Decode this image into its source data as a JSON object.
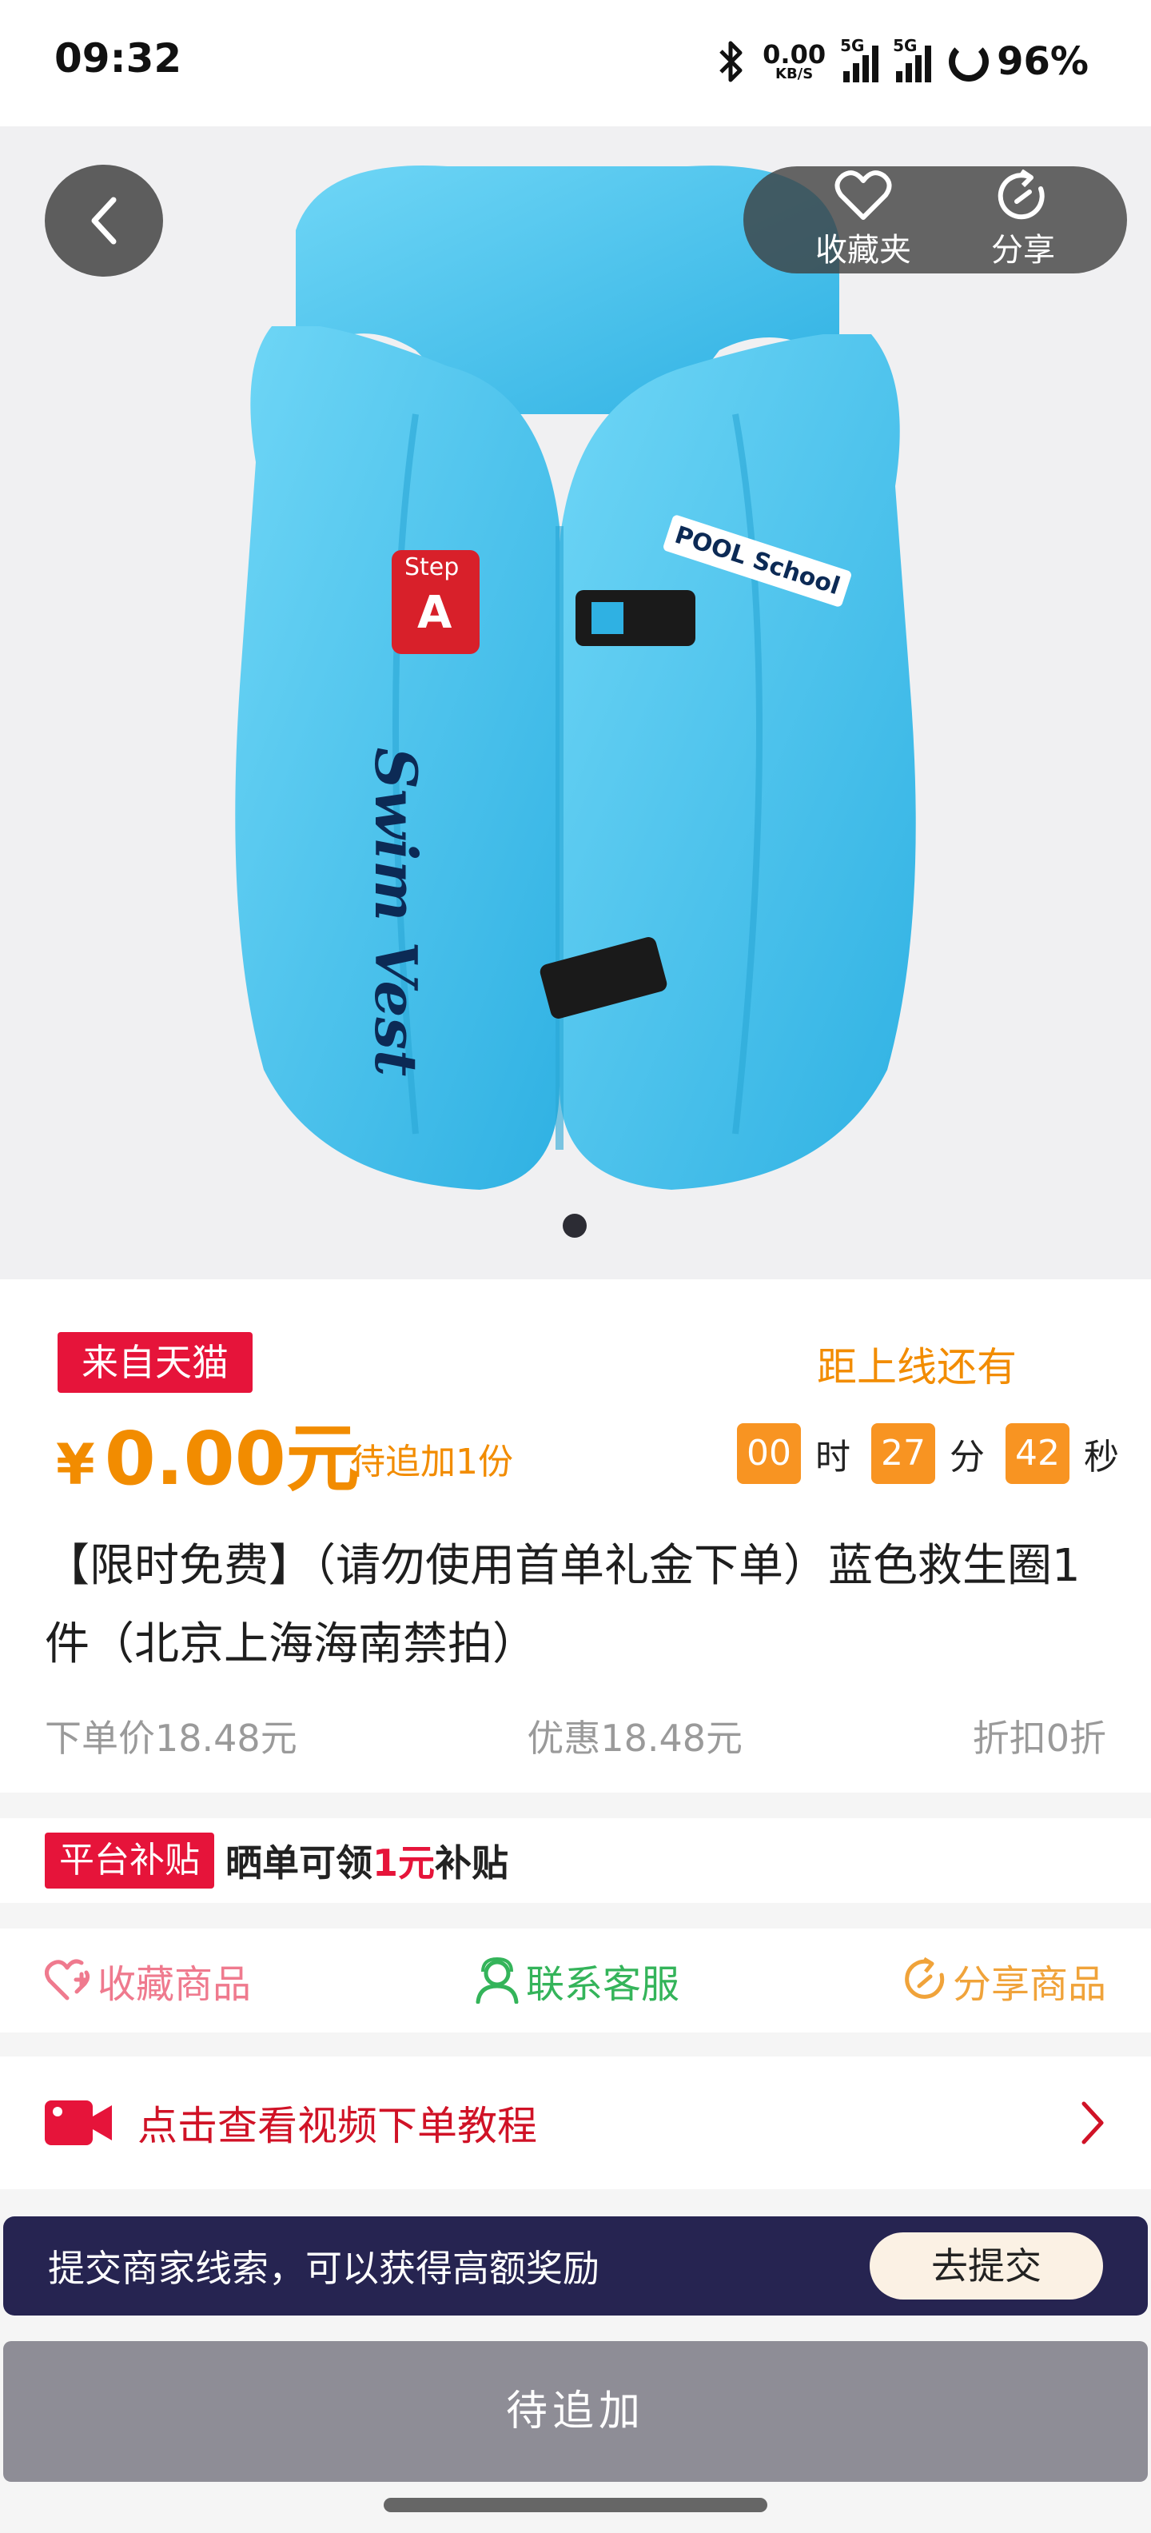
{
  "status_bar": {
    "time": "09:32",
    "speed_value": "0.00",
    "speed_unit": "KB/S",
    "sim1": "5G",
    "sim2": "5G",
    "battery": "96%"
  },
  "hero": {
    "image_text_badge_top": "Step",
    "image_text_badge_letter": "A",
    "image_text_vest": "Swim Vest",
    "image_text_pool": "POOL School",
    "image_icon": "inflatable-swim-vest-image",
    "favorite_label": "收藏夹",
    "share_label": "分享",
    "carousel_count": 1
  },
  "product": {
    "source_tag": "来自天猫",
    "price_symbol": "¥",
    "price_value": "0.00元",
    "pending_note": "待追加1份",
    "countdown_label": "距上线还有",
    "countdown": {
      "hours": "00",
      "hours_unit": "时",
      "minutes": "27",
      "minutes_unit": "分",
      "seconds": "42",
      "seconds_unit": "秒"
    },
    "title": "【限时免费】（请勿使用首单礼金下单）蓝色救生圈1件（北京上海海南禁拍）",
    "order_price": "下单价18.48元",
    "discount": "优惠18.48元",
    "rebate": "折扣0折"
  },
  "subsidy": {
    "tag": "平台补贴",
    "text_pre": "晒单可领",
    "amount": "1元",
    "text_post": "补贴"
  },
  "actions": {
    "favorite": "收藏商品",
    "customer_service": "联系客服",
    "share": "分享商品"
  },
  "video": {
    "label": "点击查看视频下单教程"
  },
  "merchant": {
    "text": "提交商家线索，可以获得高额奖励",
    "button": "去提交"
  },
  "bottom": {
    "button": "待追加"
  },
  "colors": {
    "accent_orange": "#f28c00",
    "tag_red": "#e6143a",
    "merchant_bg": "#262451",
    "disabled_button": "#8e8d96",
    "vest_blue": "#4fc6ee"
  }
}
